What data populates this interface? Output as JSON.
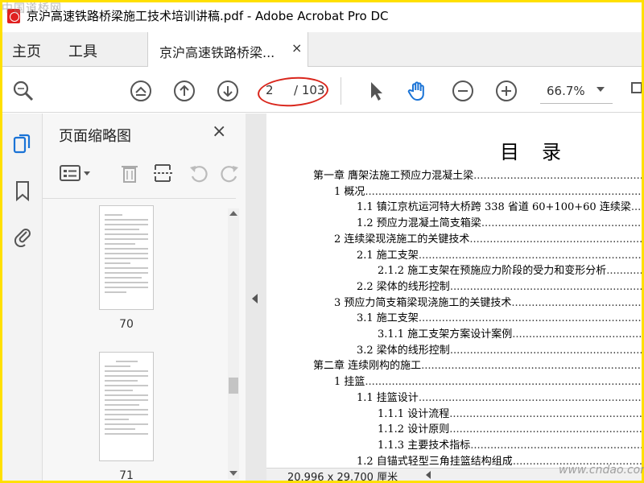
{
  "window": {
    "title": "京沪高速铁路桥梁施工技术培训讲稿.pdf - Adobe Acrobat Pro DC"
  },
  "menu": {
    "home": "主页",
    "tools": "工具",
    "tab_label": "京沪高速铁路桥梁...",
    "tab_close": "×"
  },
  "toolbar": {
    "current_page": "2",
    "total_pages": "/ 103",
    "zoom": "66.7%"
  },
  "panel": {
    "title": "页面缩略图",
    "close": "×",
    "thumbnails": [
      {
        "page": "70"
      },
      {
        "page": "71"
      }
    ]
  },
  "document": {
    "heading": "目录",
    "toc": [
      {
        "text": "第一章 膺架法施工预应力混凝土梁",
        "indent": 0
      },
      {
        "text": "1 概况",
        "indent": 1
      },
      {
        "text": "1.1 镇江京杭运河特大桥跨 338 省道 60+100+60 连续梁",
        "indent": 2
      },
      {
        "text": "1.2 预应力混凝土简支箱梁",
        "indent": 2
      },
      {
        "text": "2 连续梁现浇施工的关键技术",
        "indent": 1
      },
      {
        "text": "2.1 施工支架",
        "indent": 2
      },
      {
        "text": "2.1.2 施工支架在预施应力阶段的受力和变形分析",
        "indent": 3
      },
      {
        "text": "2.2 梁体的线形控制",
        "indent": 2
      },
      {
        "text": "3 预应力简支箱梁现浇施工的关键技术",
        "indent": 1
      },
      {
        "text": "3.1 施工支架",
        "indent": 2
      },
      {
        "text": "3.1.1 施工支架方案设计案例",
        "indent": 3
      },
      {
        "text": "3.2 梁体的线形控制",
        "indent": 2
      },
      {
        "text": "第二章 连续刚构的施工",
        "indent": 0
      },
      {
        "text": "1 挂篮",
        "indent": 1
      },
      {
        "text": "1.1 挂篮设计",
        "indent": 2
      },
      {
        "text": "1.1.1 设计流程",
        "indent": 3
      },
      {
        "text": "1.1.2 设计原则",
        "indent": 3
      },
      {
        "text": "1.1.3 主要技术指标",
        "indent": 3
      },
      {
        "text": "1.2 自锚式轻型三角挂篮结构组成",
        "indent": 2
      }
    ]
  },
  "status": {
    "dimensions": "20.996 x 29.700 厘米"
  },
  "watermarks": {
    "top": "中国道桥网",
    "bottom": "www.cndao.com"
  }
}
